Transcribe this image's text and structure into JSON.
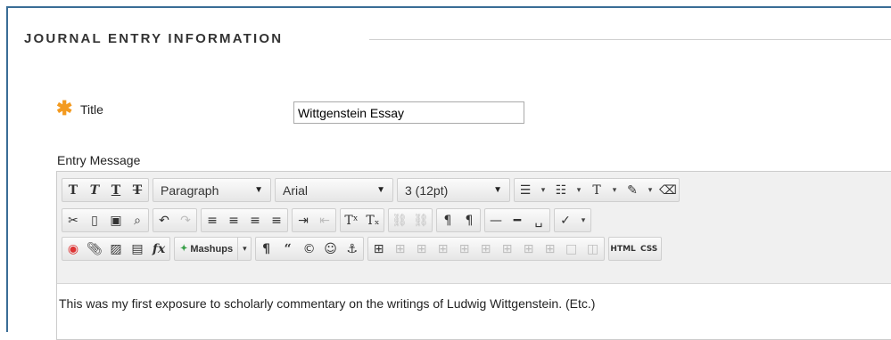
{
  "section": {
    "title": "JOURNAL ENTRY INFORMATION"
  },
  "form": {
    "required_marker": "✱",
    "title_label": "Title",
    "title_value": "Wittgenstein Essay",
    "entry_label": "Entry Message"
  },
  "toolbar": {
    "row1": {
      "format_buttons": [
        {
          "name": "bold-button",
          "glyph": "T"
        },
        {
          "name": "italic-button",
          "glyph": "T"
        },
        {
          "name": "underline-button",
          "glyph": "T"
        },
        {
          "name": "strikethrough-button",
          "glyph": "T"
        }
      ],
      "paragraph_select": "Paragraph",
      "font_select": "Arial",
      "size_select": "3 (12pt)"
    },
    "row3": {
      "mashups_label": "Mashups",
      "html_label": "HTML",
      "css_label": "CSS"
    }
  },
  "editor": {
    "content": "This was my first exposure to scholarly commentary on the writings of Ludwig Wittgenstein. (Etc.)"
  }
}
